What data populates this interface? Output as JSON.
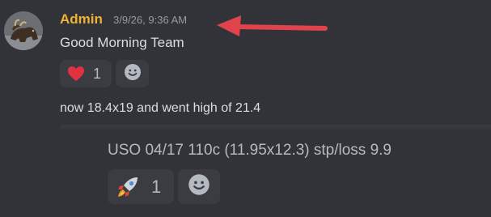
{
  "post": {
    "author": "Admin",
    "timestamp": "3/9/26, 9:36 AM",
    "message": "Good Morning Team",
    "reaction": {
      "emoji": "heart-emoji",
      "count": "1"
    }
  },
  "followup": {
    "message": "now 18.4x19 and went high of 21.4"
  },
  "embed": {
    "text": "USO 04/17 110c (11.95x12.3) stp/loss 9.9",
    "reaction": {
      "emoji": "rocket-emoji",
      "count": "1"
    }
  },
  "colors": {
    "background": "#313338",
    "author": "#f0b232",
    "arrow": "#e0434b",
    "timestamp": "#949ba4",
    "text": "#dbdee1"
  }
}
